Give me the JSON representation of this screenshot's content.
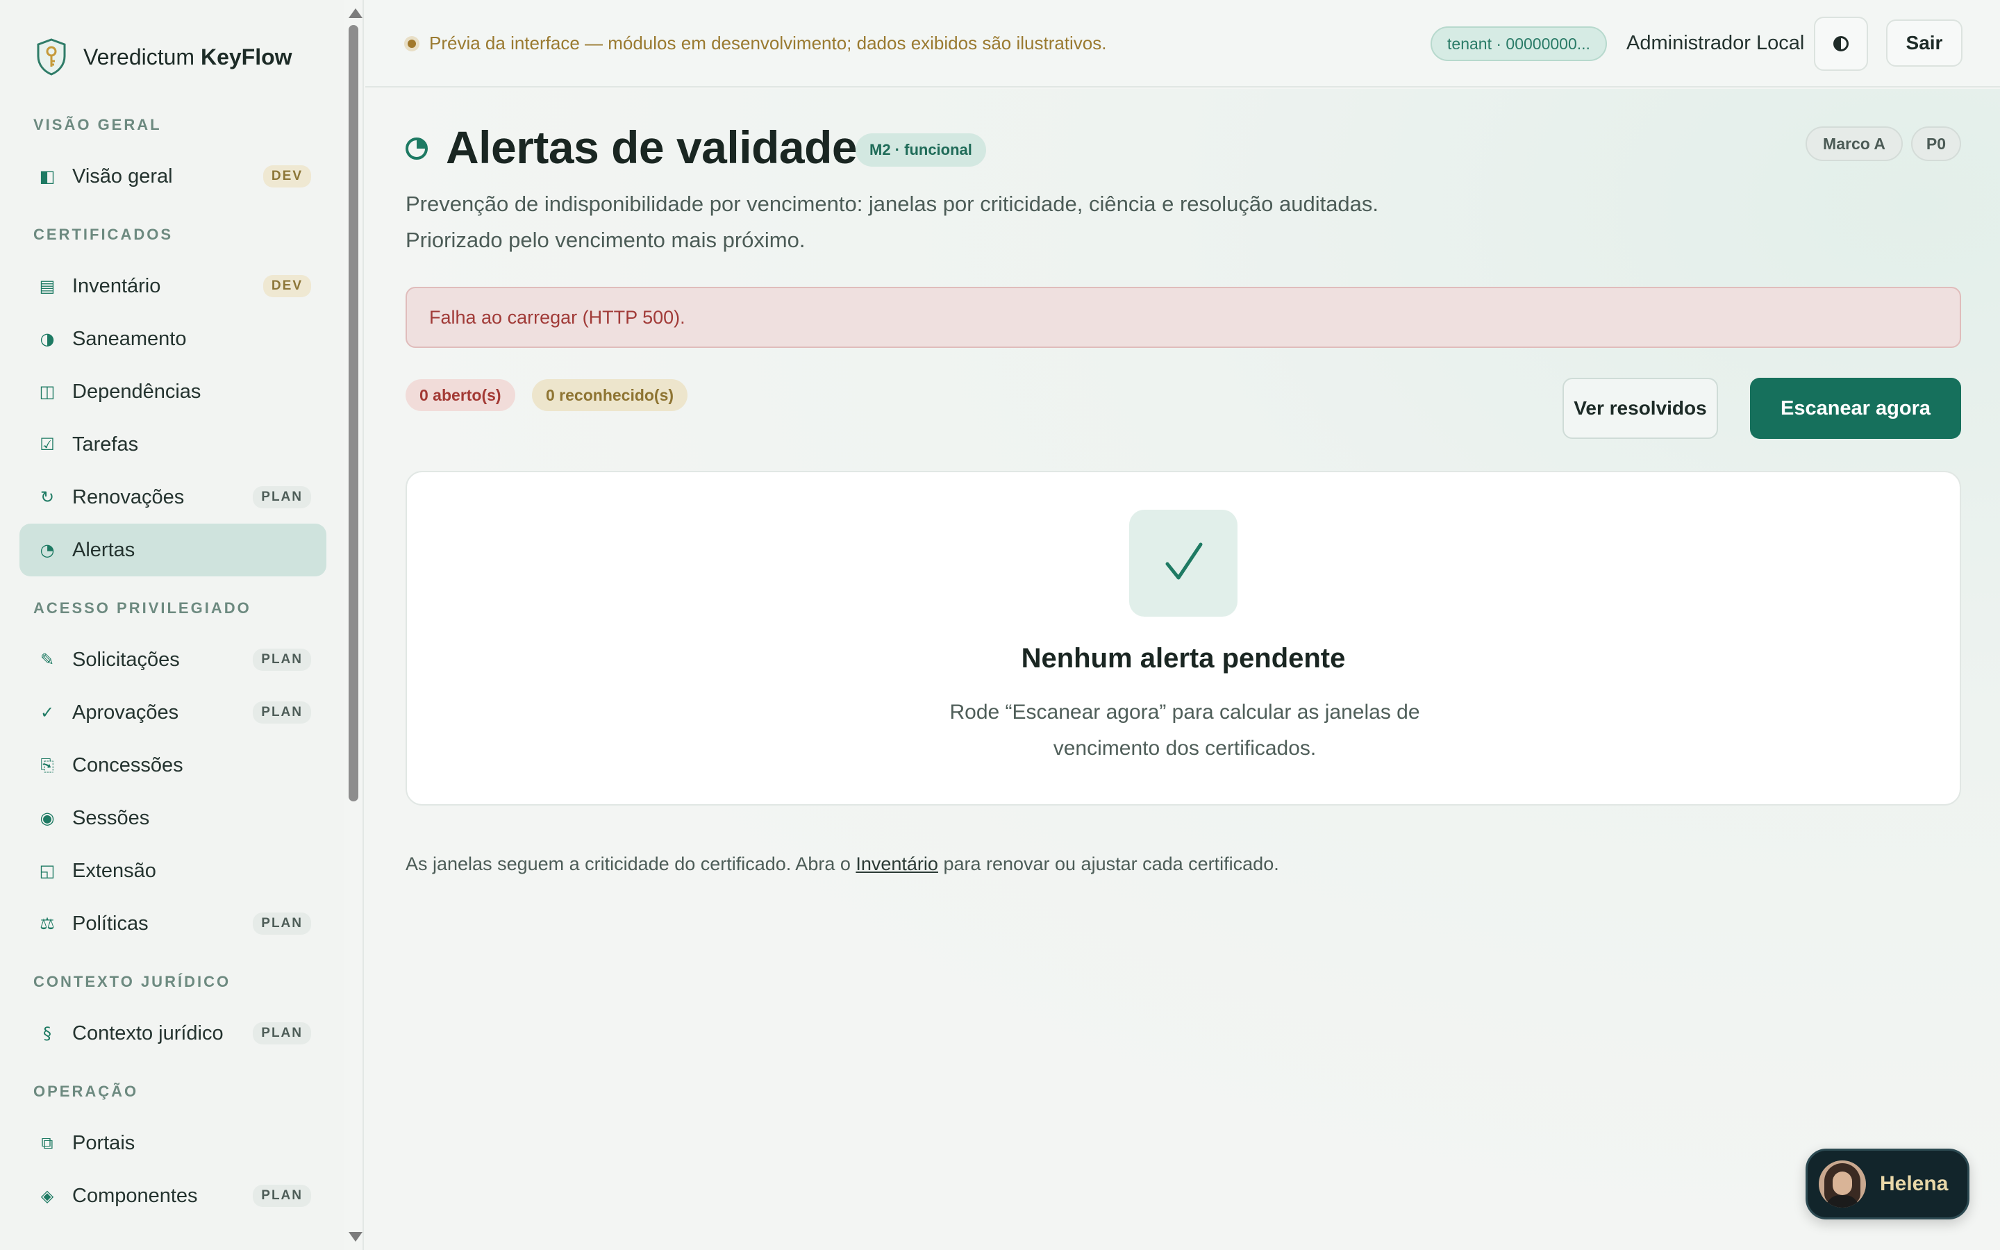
{
  "brand": {
    "name_prefix": "Veredictum",
    "name_bold": "KeyFlow"
  },
  "sidebar": {
    "sections": [
      {
        "title": "VISÃO GERAL",
        "items": [
          {
            "label": "Visão geral",
            "icon": "overview-icon",
            "glyph": "◧",
            "badge": "DEV"
          }
        ]
      },
      {
        "title": "CERTIFICADOS",
        "items": [
          {
            "label": "Inventário",
            "icon": "inventory-icon",
            "glyph": "▤",
            "badge": "DEV"
          },
          {
            "label": "Saneamento",
            "icon": "half-circle-icon",
            "glyph": "◑",
            "badge": ""
          },
          {
            "label": "Dependências",
            "icon": "columns-icon",
            "glyph": "◫",
            "badge": ""
          },
          {
            "label": "Tarefas",
            "icon": "checkbox-icon",
            "glyph": "☑",
            "badge": ""
          },
          {
            "label": "Renovações",
            "icon": "refresh-icon",
            "glyph": "↻",
            "badge": "PLAN"
          },
          {
            "label": "Alertas",
            "icon": "pie-icon",
            "glyph": "◔",
            "badge": "",
            "active": true
          }
        ]
      },
      {
        "title": "ACESSO PRIVILEGIADO",
        "items": [
          {
            "label": "Solicitações",
            "icon": "pen-icon",
            "glyph": "✎",
            "badge": "PLAN"
          },
          {
            "label": "Aprovações",
            "icon": "check-icon",
            "glyph": "✓",
            "badge": "PLAN"
          },
          {
            "label": "Concessões",
            "icon": "grant-icon",
            "glyph": "⎘",
            "badge": ""
          },
          {
            "label": "Sessões",
            "icon": "session-icon",
            "glyph": "◉",
            "badge": ""
          },
          {
            "label": "Extensão",
            "icon": "extension-icon",
            "glyph": "◱",
            "badge": ""
          },
          {
            "label": "Políticas",
            "icon": "scales-icon",
            "glyph": "⚖",
            "badge": "PLAN"
          }
        ]
      },
      {
        "title": "CONTEXTO JURÍDICO",
        "items": [
          {
            "label": "Contexto jurídico",
            "icon": "section-sign-icon",
            "glyph": "§",
            "badge": "PLAN"
          }
        ]
      },
      {
        "title": "OPERAÇÃO",
        "items": [
          {
            "label": "Portais",
            "icon": "portals-icon",
            "glyph": "⧉",
            "badge": ""
          },
          {
            "label": "Componentes",
            "icon": "diamond-icon",
            "glyph": "◈",
            "badge": "PLAN"
          }
        ]
      }
    ]
  },
  "topbar": {
    "preview_text": "Prévia da interface — módulos em desenvolvimento; dados exibidos são ilustrativos.",
    "tenant": "tenant · 00000000...",
    "user": "Administrador Local",
    "logout": "Sair"
  },
  "page": {
    "title": "Alertas de validade",
    "status_badge": "M2 · funcional",
    "milestone_badge": "Marco A",
    "priority_badge": "P0",
    "subtitle_line1": "Prevenção de indisponibilidade por vencimento: janelas por criticidade, ciência e resolução auditadas.",
    "subtitle_line2": "Priorizado pelo vencimento mais próximo.",
    "error": "Falha ao carregar (HTTP 500).",
    "count_open": "0 aberto(s)",
    "count_ack": "0 reconhecido(s)",
    "btn_resolved": "Ver resolvidos",
    "btn_scan": "Escanear agora",
    "empty_title": "Nenhum alerta pendente",
    "empty_desc": "Rode “Escanear agora” para calcular as janelas de vencimento dos certificados.",
    "footer_before": "As janelas seguem a criticidade do certificado. Abra o ",
    "footer_link": "Inventário",
    "footer_after": " para renovar ou ajustar cada certificado."
  },
  "chat": {
    "name": "Helena"
  },
  "colors": {
    "accent": "#16705c",
    "error_text": "#a13b38",
    "warning_text": "#9a7a30"
  }
}
